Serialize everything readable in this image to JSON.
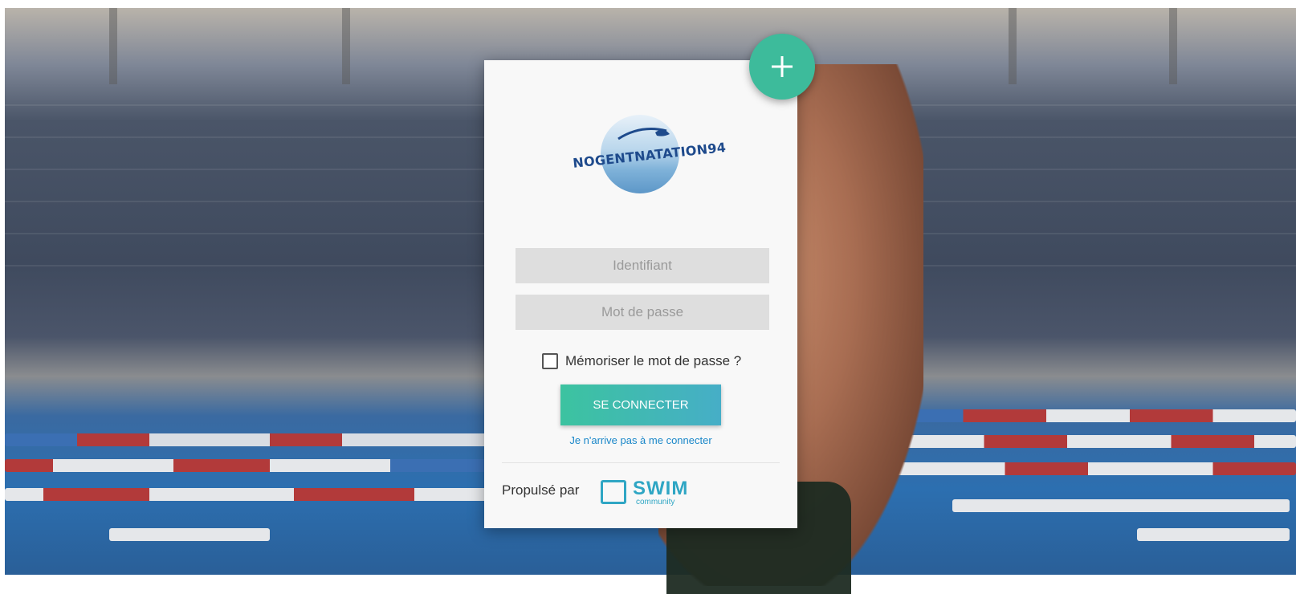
{
  "login": {
    "brand_text": "NOGENTNATATION94",
    "username_placeholder": "Identifiant",
    "password_placeholder": "Mot de passe",
    "remember_label": "Mémoriser le mot de passe ?",
    "submit_label": "SE CONNECTER",
    "forgot_link": "Je n'arrive pas à me connecter",
    "powered_by": "Propulsé par",
    "partner_name": "SWIM",
    "partner_sub": "community"
  },
  "colors": {
    "accent": "#3dbb9b",
    "link": "#1a87c9",
    "partner": "#2fa6c4",
    "brand": "#1e4a8c"
  },
  "icons": {
    "fab": "plus-icon",
    "checkbox": "checkbox-unchecked-icon"
  }
}
